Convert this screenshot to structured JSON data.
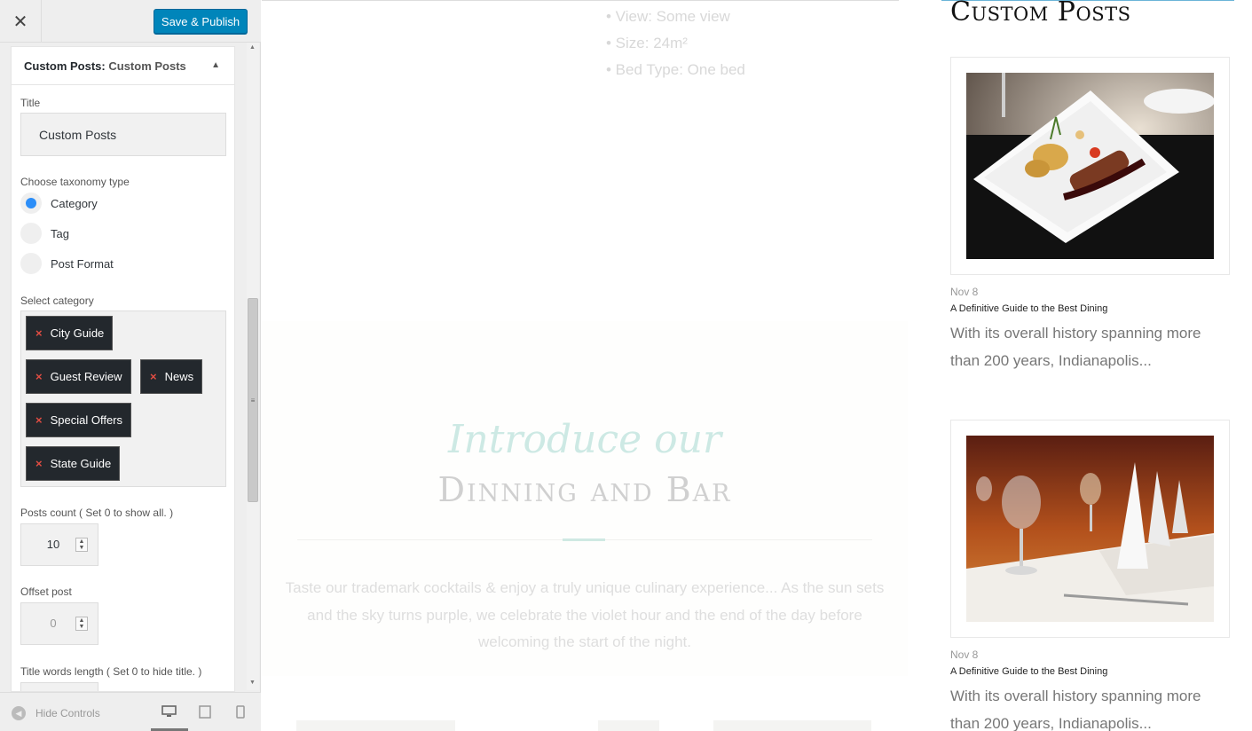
{
  "panel": {
    "close_icon": "close-icon",
    "save_label": "Save & Publish",
    "section_prefix": "Custom Posts:",
    "section_name": "Custom Posts",
    "title_label": "Title",
    "title_value": "Custom Posts",
    "taxonomy_label": "Choose taxonomy type",
    "taxonomy_options": [
      "Category",
      "Tag",
      "Post Format"
    ],
    "taxonomy_selected": "Category",
    "category_label": "Select category",
    "categories": [
      "City Guide",
      "Guest Review",
      "News",
      "Special Offers",
      "State Guide"
    ],
    "posts_count_label": "Posts count ( Set 0 to show all. )",
    "posts_count_value": "10",
    "offset_label": "Offset post",
    "offset_value": "0",
    "title_words_label": "Title words length ( Set 0 to hide title. )"
  },
  "footer": {
    "hide_controls_label": "Hide Controls",
    "devices": [
      "desktop",
      "tablet",
      "mobile"
    ],
    "active_device": "desktop"
  },
  "preview": {
    "room_specs": [
      "• View: Some view",
      "• Size: 24m²",
      "• Bed Type: One bed"
    ],
    "intro_script": "Introduce our",
    "intro_title": "Dinning and Bar",
    "intro_text": "Taste our trademark cocktails & enjoy a truly unique culinary experience... As the sun sets and the sky turns purple, we celebrate the violet hour and the end of the day before welcoming the start of the night.",
    "widget_title": "Custom Posts",
    "posts": [
      {
        "date": "Nov 8",
        "title": "A Definitive Guide to the Best Dining",
        "excerpt": "With its overall history spanning more than 200 years, Indianapolis..."
      },
      {
        "date": "Nov 8",
        "title": "A Definitive Guide to the Best Dining",
        "excerpt": "With its overall history spanning more than 200 years, Indianapolis..."
      }
    ]
  },
  "colors": {
    "primary_button": "#0085ba",
    "radio_checked": "#2c8ef8",
    "chip_bg": "#23282d",
    "chip_remove": "#e14d43"
  }
}
